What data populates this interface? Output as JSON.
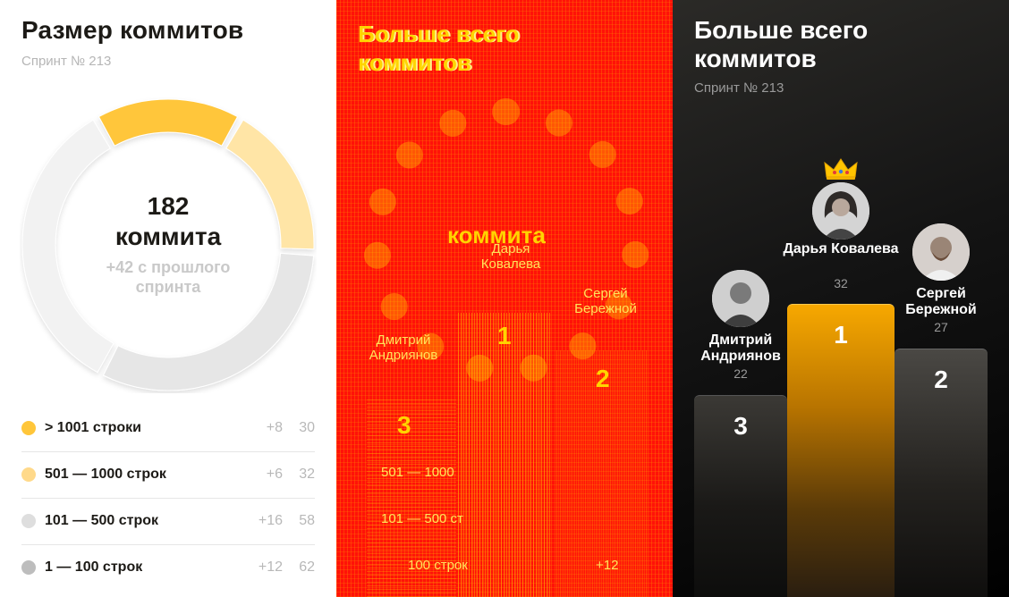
{
  "left_panel": {
    "title": "Размер коммитов",
    "subtitle": "Спринт № 213",
    "total": "182",
    "total_unit": "коммита",
    "delta_text": "+42 с прошлого спринта",
    "donut": {
      "values": [
        30,
        32,
        58,
        62
      ],
      "colors": [
        "#ffc63a",
        "#ffe5a6",
        "#e6e6e6",
        "#f2f2f2"
      ]
    },
    "legend": [
      {
        "label": "> 1001 строки",
        "delta": "+8",
        "count": "30",
        "color": "#ffc63a"
      },
      {
        "label": "501 — 1000 строк",
        "delta": "+6",
        "count": "32",
        "color": "#ffd98a"
      },
      {
        "label": "101 — 500 строк",
        "delta": "+16",
        "count": "58",
        "color": "#dedede"
      },
      {
        "label": "1 — 100 строк",
        "delta": "+12",
        "count": "62",
        "color": "#bdbdbd"
      }
    ]
  },
  "glitch_panel": {
    "title": "Больше всего коммитов",
    "center_unit": "коммита",
    "name_center": "Дарья Ковалева",
    "name_right": "Сергей Бережной",
    "name_left": "Дмитрий Андриянов",
    "rank_1": "1",
    "rank_2": "2",
    "rank_3": "3",
    "legend_2": "501 — 1000",
    "legend_3": "101 — 500 ст",
    "legend_4": "100 строк",
    "legend_4_delta": "+12"
  },
  "right_panel": {
    "title": "Больше всего коммитов",
    "subtitle": "Спринт № 213",
    "crown_icon": "crown-icon",
    "podium": [
      {
        "rank": "1",
        "name": "Дарья Ковалева",
        "count": "32"
      },
      {
        "rank": "2",
        "name": "Сергей Бережной",
        "count": "27"
      },
      {
        "rank": "3",
        "name": "Дмитрий Андриянов",
        "count": "22"
      }
    ]
  }
}
